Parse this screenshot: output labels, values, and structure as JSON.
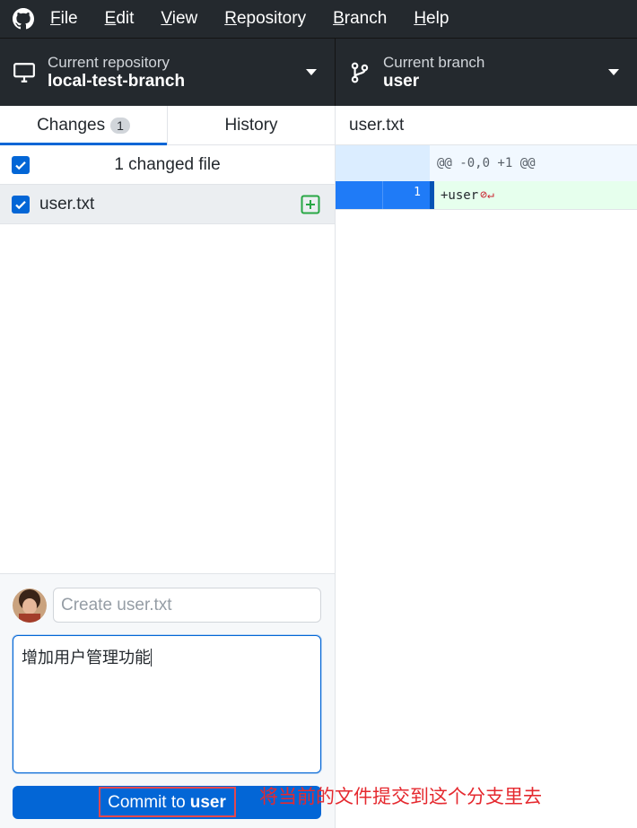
{
  "menubar": {
    "items": [
      {
        "acc": "F",
        "rest": "ile"
      },
      {
        "acc": "E",
        "rest": "dit"
      },
      {
        "acc": "V",
        "rest": "iew"
      },
      {
        "acc": "R",
        "rest": "epository"
      },
      {
        "acc": "B",
        "rest": "ranch"
      },
      {
        "acc": "H",
        "rest": "elp"
      }
    ]
  },
  "toolbar": {
    "repo_label": "Current repository",
    "repo_value": "local-test-branch",
    "branch_label": "Current branch",
    "branch_value": "user"
  },
  "tabs": {
    "changes_label": "Changes",
    "changes_count": "1",
    "history_label": "History"
  },
  "changes": {
    "header": "1 changed file",
    "files": [
      {
        "name": "user.txt",
        "status_icon": "file-added-icon"
      }
    ]
  },
  "commit": {
    "summary_placeholder": "Create user.txt",
    "summary_value": "",
    "description": "增加用户管理功能",
    "button_prefix": "Commit to",
    "button_branch": "user"
  },
  "diff": {
    "file_name": "user.txt",
    "hunk_header": "@@ -0,0 +1 @@",
    "lines": [
      {
        "new_number": "1",
        "text": "+user",
        "whitespace_icons": "⊘↵"
      }
    ]
  },
  "annotation": "将当前的文件提交到这个分支里去",
  "colors": {
    "menubar_bg": "#24292e",
    "accent_blue": "#0366d6",
    "added_green": "#28a745",
    "annotation_red": "#e5292f"
  }
}
